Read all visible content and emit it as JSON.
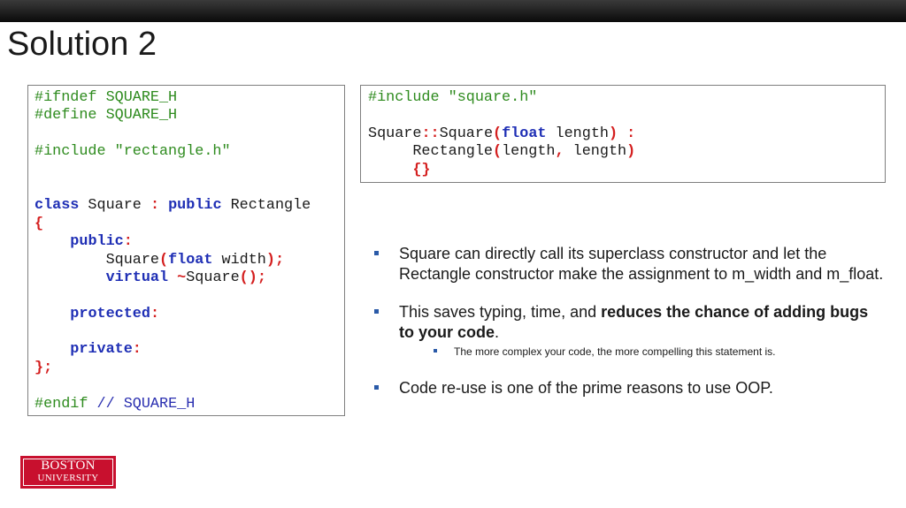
{
  "slide": {
    "title": "Solution 2"
  },
  "header_code": {
    "l1": "#ifndef SQUARE_H",
    "l2": "#define SQUARE_H",
    "l4": "#include \"rectangle.h\"",
    "l7_class": "class",
    "l7_name": " Square ",
    "l7_colon": ":",
    "l7_public": " public",
    "l7_base": " Rectangle",
    "l8": "{",
    "l9_public": "public",
    "l9_colon": ":",
    "l10_name": "Square",
    "l10_paren_open": "(",
    "l10_float": "float",
    "l10_param": " width",
    "l10_end": ");",
    "l11_virtual": "virtual",
    "l11_tilde": " ~",
    "l11_name": "Square",
    "l11_end": "();",
    "l13_protected": "protected",
    "l13_colon": ":",
    "l15_private": "private",
    "l15_colon": ":",
    "l16": "};",
    "l18_endif": "#endif",
    "l18_comment": " // SQUARE_H"
  },
  "impl_code": {
    "l1": "#include \"square.h\"",
    "l3_a": "Square",
    "l3_scope": "::",
    "l3_b": "Square",
    "l3_po": "(",
    "l3_float": "float",
    "l3_param": " length",
    "l3_pc": ")",
    "l3_colon": " :",
    "l4_name": "Rectangle",
    "l4_po": "(",
    "l4_arg1": "length",
    "l4_comma": ",",
    "l4_arg2": " length",
    "l4_pc": ")",
    "l5": "{}"
  },
  "bullets": {
    "b1": "Square can directly call its superclass constructor and let the Rectangle constructor make the assignment to m_width and m_float.",
    "b2_pre": "This saves typing, time, and ",
    "b2_bold": "reduces the chance of adding bugs to your code",
    "b2_post": ".",
    "b2_sub": "The more complex your code, the more compelling this statement is.",
    "b3": "Code re-use is one of the prime reasons to use OOP."
  },
  "logo": {
    "line1": "BOSTON",
    "line2": "UNIVERSITY",
    "color": "#c8102e"
  }
}
